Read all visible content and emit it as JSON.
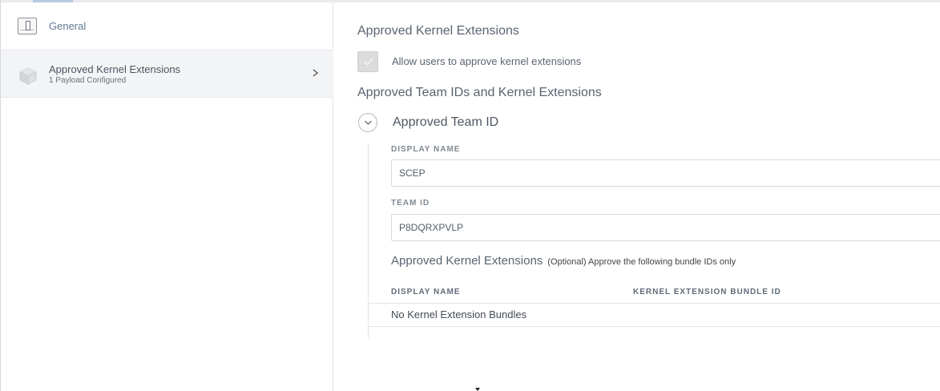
{
  "sidebar": {
    "general": {
      "label": "General",
      "icon": "general-icon"
    },
    "kext": {
      "label": "Approved Kernel Extensions",
      "sublabel": "1 Payload Configured",
      "icon": "kernel-extension-cube-icon"
    }
  },
  "main": {
    "section_title": "Approved Kernel Extensions",
    "allow_checkbox_label": "Allow users to approve kernel extensions",
    "allow_checked": true,
    "team_section_title": "Approved Team IDs and Kernel Extensions",
    "team_title": "Approved Team ID",
    "display_name_label": "DISPLAY NAME",
    "display_name_value": "SCEP",
    "team_id_label": "TEAM ID",
    "team_id_value": "P8DQRXPVLP",
    "kext_subheading": "Approved Kernel Extensions",
    "kext_hint": "(Optional) Approve the following bundle IDs only",
    "table": {
      "columns": [
        "DISPLAY NAME",
        "KERNEL EXTENSION BUNDLE ID"
      ],
      "empty_text": "No Kernel Extension Bundles"
    }
  },
  "colors": {
    "accent": "#627894",
    "checkbox_bg": "#dcdcdc",
    "selected_row_bg": "#f3f4f6"
  }
}
